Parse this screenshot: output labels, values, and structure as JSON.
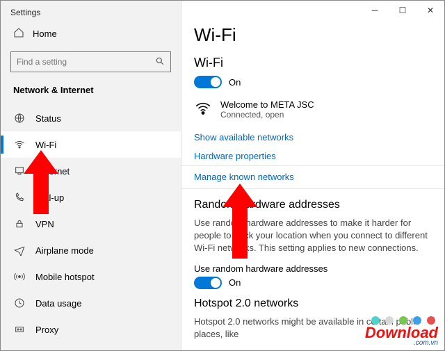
{
  "window": {
    "title": "Settings"
  },
  "sidebar": {
    "home": "Home",
    "search_placeholder": "Find a setting",
    "category": "Network & Internet",
    "items": [
      {
        "label": "Status"
      },
      {
        "label": "Wi-Fi"
      },
      {
        "label": "Ethernet"
      },
      {
        "label": "Dial-up"
      },
      {
        "label": "VPN"
      },
      {
        "label": "Airplane mode"
      },
      {
        "label": "Mobile hotspot"
      },
      {
        "label": "Data usage"
      },
      {
        "label": "Proxy"
      }
    ]
  },
  "main": {
    "heading": "Wi-Fi",
    "wifi_section": "Wi-Fi",
    "toggle_on": "On",
    "network_name": "Welcome to META JSC",
    "network_status": "Connected, open",
    "link_show": "Show available networks",
    "link_hardware": "Hardware properties",
    "link_manage": "Manage known networks",
    "random_heading": "Random hardware addresses",
    "random_body": "Use random hardware addresses to make it harder for people to track your location when you connect to different Wi-Fi networks. This setting applies to new connections.",
    "random_label": "Use random hardware addresses",
    "random_toggle": "On",
    "hotspot_heading": "Hotspot 2.0 networks",
    "hotspot_body": "Hotspot 2.0 networks might be available in certain public places, like"
  },
  "watermark": {
    "brand_a": "Down",
    "brand_b": "load",
    "domain": ".com.vn"
  },
  "dots_colors": [
    "#4dd3c9",
    "#d8d8d8",
    "#78c850",
    "#3aa0e8",
    "#e85050"
  ]
}
